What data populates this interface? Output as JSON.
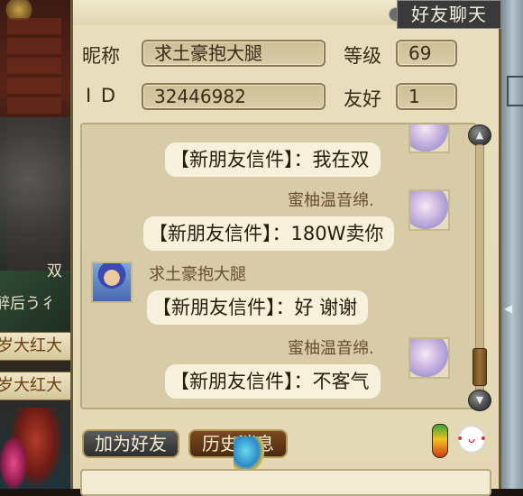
{
  "scene": {
    "labels": [
      "岁大红大",
      "岁大红大"
    ],
    "texts": [
      "双",
      "醉后う彳"
    ]
  },
  "window": {
    "title": "好友聊天"
  },
  "profile": {
    "nickname_label": "昵称",
    "nickname_value": "求土豪抱大腿",
    "level_label": "等级",
    "level_value": "69",
    "id_label": "I D",
    "id_value": "32446982",
    "friendship_label": "友好",
    "friendship_value": "1"
  },
  "chat": {
    "messages": [
      {
        "sender": "",
        "text": "【新朋友信件】：我在双",
        "side": "right",
        "avatar": "girl-avatar"
      },
      {
        "sender": "蜜柚温音绵.",
        "text": "【新朋友信件】：180W卖你",
        "side": "right",
        "avatar": "girl-avatar"
      },
      {
        "sender": "求土豪抱大腿",
        "text": "【新朋友信件】：好 谢谢",
        "side": "left",
        "avatar": "boy-avatar"
      },
      {
        "sender": "蜜柚温音绵.",
        "text": "【新朋友信件】：不客气",
        "side": "right",
        "avatar": "girl-avatar"
      }
    ]
  },
  "buttons": {
    "add_friend": "加为好友",
    "history": "历史消息"
  },
  "icons": {
    "scroll_up": "scroll-up-icon",
    "scroll_down": "scroll-down-icon",
    "gourd": "gourd-icon",
    "emoticon": "emoticon-icon"
  },
  "colors": {
    "panel_bg": "#e4d8b4",
    "bubble_bg": "#f6f0dc",
    "title_bg": "#3a3a3a"
  }
}
